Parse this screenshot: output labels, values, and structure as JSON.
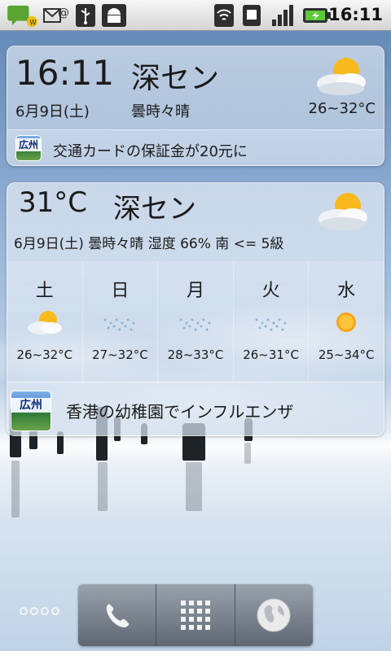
{
  "status_bar": {
    "time": "16:11",
    "left_icons": [
      "messaging-icon",
      "email-at-icon",
      "usb-icon",
      "android-debug-icon"
    ],
    "right_icons": [
      "wifi-icon",
      "sim-icon",
      "signal-icon",
      "battery-charging-icon"
    ]
  },
  "widget_clock_weather": {
    "time": "16:11",
    "city": "深セン",
    "date": "6月9日(土)",
    "condition": "曇時々晴",
    "temp_range": "26~32°C",
    "icon": "partly-cloudy-icon",
    "news": {
      "badge": "広州",
      "headline": "交通カードの保証金が20元に"
    }
  },
  "widget_forecast": {
    "current_temp": "31°C",
    "city": "深セン",
    "detail": "6月9日(土)  曇時々晴 湿度 66% 南 <= 5級",
    "icon": "partly-cloudy-icon",
    "days": [
      {
        "name": "土",
        "icon": "partly-cloudy-icon",
        "temp": "26~32°C"
      },
      {
        "name": "日",
        "icon": "rain-icon",
        "temp": "27~32°C"
      },
      {
        "name": "月",
        "icon": "rain-icon",
        "temp": "28~33°C"
      },
      {
        "name": "火",
        "icon": "rain-icon",
        "temp": "26~31°C"
      },
      {
        "name": "水",
        "icon": "sun-icon",
        "temp": "25~34°C"
      }
    ],
    "news": {
      "badge": "広州",
      "headline": "香港の幼稚園でインフルエンザ"
    }
  },
  "dock": {
    "items": [
      "phone-icon",
      "app-grid-icon",
      "browser-globe-icon"
    ]
  }
}
